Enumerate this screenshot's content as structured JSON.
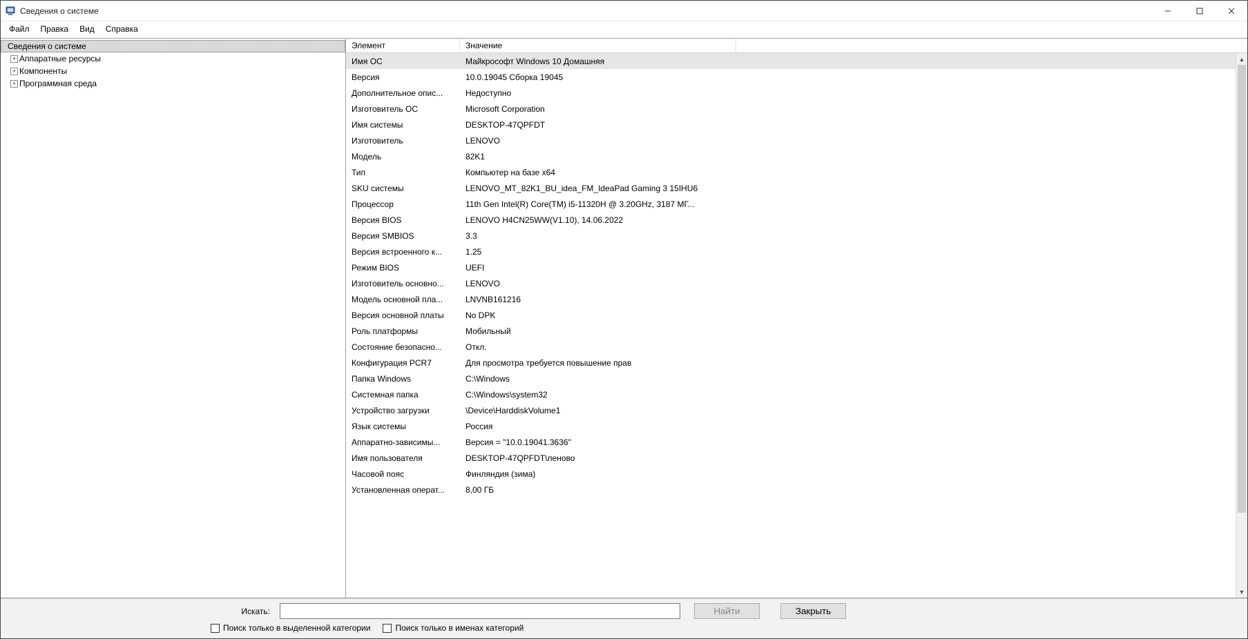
{
  "window": {
    "title": "Сведения о системе"
  },
  "menu": {
    "file": "Файл",
    "edit": "Правка",
    "view": "Вид",
    "help": "Справка"
  },
  "tree": {
    "root": "Сведения о системе",
    "items": [
      {
        "label": "Аппаратные ресурсы"
      },
      {
        "label": "Компоненты"
      },
      {
        "label": "Программная среда"
      }
    ]
  },
  "details": {
    "headers": {
      "element": "Элемент",
      "value": "Значение"
    },
    "rows": [
      {
        "el": "Имя ОС",
        "val": "Майкрософт Windows 10 Домашняя",
        "selected": true
      },
      {
        "el": "Версия",
        "val": "10.0.19045 Сборка 19045"
      },
      {
        "el": "Дополнительное опис...",
        "val": "Недоступно"
      },
      {
        "el": "Изготовитель ОС",
        "val": "Microsoft Corporation"
      },
      {
        "el": "Имя системы",
        "val": "DESKTOP-47QPFDT"
      },
      {
        "el": "Изготовитель",
        "val": "LENOVO"
      },
      {
        "el": "Модель",
        "val": "82K1"
      },
      {
        "el": "Тип",
        "val": "Компьютер на базе x64"
      },
      {
        "el": "SKU системы",
        "val": "LENOVO_MT_82K1_BU_idea_FM_IdeaPad Gaming 3 15IHU6"
      },
      {
        "el": "Процессор",
        "val": "11th Gen Intel(R) Core(TM) i5-11320H @ 3.20GHz, 3187 МГ..."
      },
      {
        "el": "Версия BIOS",
        "val": "LENOVO H4CN25WW(V1.10), 14.06.2022"
      },
      {
        "el": "Версия SMBIOS",
        "val": "3.3"
      },
      {
        "el": "Версия встроенного к...",
        "val": "1.25"
      },
      {
        "el": "Режим BIOS",
        "val": "UEFI"
      },
      {
        "el": "Изготовитель основно...",
        "val": "LENOVO"
      },
      {
        "el": "Модель основной пла...",
        "val": "LNVNB161216"
      },
      {
        "el": "Версия основной платы",
        "val": "No DPK"
      },
      {
        "el": "Роль платформы",
        "val": "Мобильный"
      },
      {
        "el": "Состояние безопасно...",
        "val": "Откл."
      },
      {
        "el": "Конфигурация PCR7",
        "val": "Для просмотра требуется повышение прав"
      },
      {
        "el": "Папка Windows",
        "val": "C:\\Windows"
      },
      {
        "el": "Системная папка",
        "val": "C:\\Windows\\system32"
      },
      {
        "el": "Устройство загрузки",
        "val": "\\Device\\HarddiskVolume1"
      },
      {
        "el": "Язык системы",
        "val": "Россия"
      },
      {
        "el": "Аппаратно-зависимы...",
        "val": "Версия = \"10.0.19041.3636\""
      },
      {
        "el": "Имя пользователя",
        "val": "DESKTOP-47QPFDT\\леново"
      },
      {
        "el": "Часовой пояс",
        "val": "Финляндия (зима)"
      },
      {
        "el": "Установленная операт...",
        "val": "8,00 ГБ"
      }
    ]
  },
  "bottom": {
    "search_label": "Искать:",
    "find": "Найти",
    "close": "Закрыть",
    "chk_selected_category": "Поиск только в выделенной категории",
    "chk_names_only": "Поиск только в именах категорий"
  }
}
